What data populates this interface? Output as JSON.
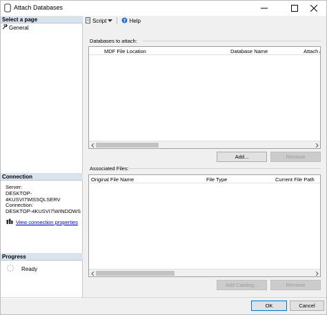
{
  "window": {
    "title": "Attach Databases",
    "controls": {
      "minimize": "minimize",
      "maximize": "maximize",
      "close": "close"
    }
  },
  "sidebar": {
    "select_page_header": "Select a page",
    "pages": [
      {
        "label": "General",
        "icon": "wrench-icon"
      }
    ],
    "connection_header": "Connection",
    "server_label": "Server:",
    "server_value": "DESKTOP-4KUSVI7\\MSSQLSERV",
    "connection_label": "Connection:",
    "connection_value": "DESKTOP-4KUSVI7\\WINDOWS",
    "view_connection_link": "View connection properties",
    "progress_header": "Progress",
    "progress_status": "Ready"
  },
  "toolbar": {
    "script_label": "Script",
    "help_label": "Help"
  },
  "databases": {
    "group_label": "Databases to attach:",
    "columns": [
      "MDF File Location",
      "Database Name",
      "Attach A"
    ],
    "add_button": "Add...",
    "remove_button": "Remove"
  },
  "files": {
    "group_label": "Associated Files:",
    "columns": [
      "Original File Name",
      "File Type",
      "Current File Path"
    ],
    "add_catalog_button": "Add Catalog...",
    "remove_button": "Remove"
  },
  "footer": {
    "ok_button": "OK",
    "cancel_button": "Cancel"
  }
}
